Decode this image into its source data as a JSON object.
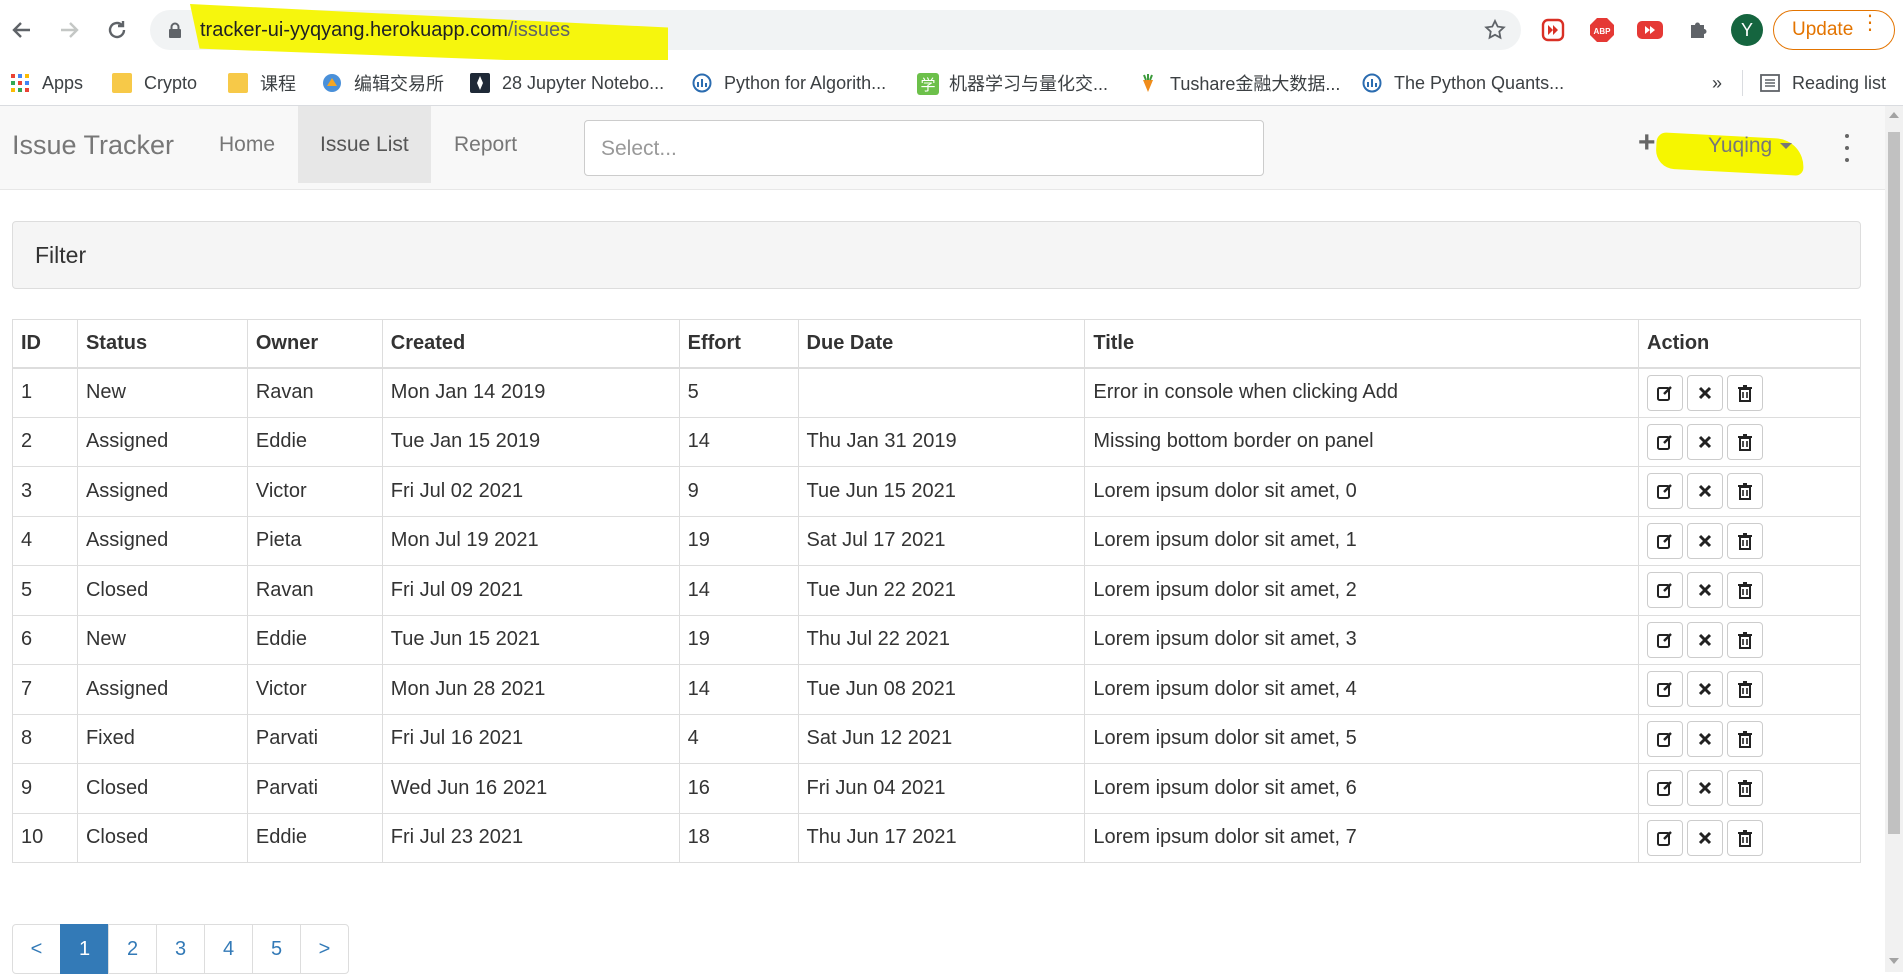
{
  "browser": {
    "url_host": "tracker-ui-yyqyang.herokuapp.com",
    "url_path": "/issues",
    "profile_initial": "Y",
    "update_label": "Update",
    "bookmarks": [
      {
        "label": "Apps",
        "icon": "apps-grid-icon"
      },
      {
        "label": "Crypto",
        "icon": "folder-icon"
      },
      {
        "label": "课程",
        "icon": "folder-icon"
      },
      {
        "label": "编辑交易所",
        "icon": "exchange-icon"
      },
      {
        "label": "28 Jupyter Notebo...",
        "icon": "jupyter-icon"
      },
      {
        "label": "Python for Algorith...",
        "icon": "site-icon"
      },
      {
        "label": "机器学习与量化交...",
        "icon": "xue-icon"
      },
      {
        "label": "Tushare金融大数据...",
        "icon": "carrot-icon"
      },
      {
        "label": "The Python Quants...",
        "icon": "site-icon"
      }
    ],
    "more_bookmarks": "»",
    "reading_list": "Reading list"
  },
  "navbar": {
    "brand": "Issue Tracker",
    "links": [
      "Home",
      "Issue List",
      "Report"
    ],
    "active_link": "Issue List",
    "select_placeholder": "Select...",
    "add_symbol": "+",
    "user": "Yuqing"
  },
  "filter": {
    "title": "Filter"
  },
  "table": {
    "headers": [
      "ID",
      "Status",
      "Owner",
      "Created",
      "Effort",
      "Due Date",
      "Title",
      "Action"
    ],
    "rows": [
      {
        "id": "1",
        "status": "New",
        "owner": "Ravan",
        "created": "Mon Jan 14 2019",
        "effort": "5",
        "due": "",
        "title": "Error in console when clicking Add"
      },
      {
        "id": "2",
        "status": "Assigned",
        "owner": "Eddie",
        "created": "Tue Jan 15 2019",
        "effort": "14",
        "due": "Thu Jan 31 2019",
        "title": "Missing bottom border on panel"
      },
      {
        "id": "3",
        "status": "Assigned",
        "owner": "Victor",
        "created": "Fri Jul 02 2021",
        "effort": "9",
        "due": "Tue Jun 15 2021",
        "title": "Lorem ipsum dolor sit amet, 0"
      },
      {
        "id": "4",
        "status": "Assigned",
        "owner": "Pieta",
        "created": "Mon Jul 19 2021",
        "effort": "19",
        "due": "Sat Jul 17 2021",
        "title": "Lorem ipsum dolor sit amet, 1"
      },
      {
        "id": "5",
        "status": "Closed",
        "owner": "Ravan",
        "created": "Fri Jul 09 2021",
        "effort": "14",
        "due": "Tue Jun 22 2021",
        "title": "Lorem ipsum dolor sit amet, 2"
      },
      {
        "id": "6",
        "status": "New",
        "owner": "Eddie",
        "created": "Tue Jun 15 2021",
        "effort": "19",
        "due": "Thu Jul 22 2021",
        "title": "Lorem ipsum dolor sit amet, 3"
      },
      {
        "id": "7",
        "status": "Assigned",
        "owner": "Victor",
        "created": "Mon Jun 28 2021",
        "effort": "14",
        "due": "Tue Jun 08 2021",
        "title": "Lorem ipsum dolor sit amet, 4"
      },
      {
        "id": "8",
        "status": "Fixed",
        "owner": "Parvati",
        "created": "Fri Jul 16 2021",
        "effort": "4",
        "due": "Sat Jun 12 2021",
        "title": "Lorem ipsum dolor sit amet, 5"
      },
      {
        "id": "9",
        "status": "Closed",
        "owner": "Parvati",
        "created": "Wed Jun 16 2021",
        "effort": "16",
        "due": "Fri Jun 04 2021",
        "title": "Lorem ipsum dolor sit amet, 6"
      },
      {
        "id": "10",
        "status": "Closed",
        "owner": "Eddie",
        "created": "Fri Jul 23 2021",
        "effort": "18",
        "due": "Thu Jun 17 2021",
        "title": "Lorem ipsum dolor sit amet, 7"
      }
    ],
    "action_icons": [
      "edit-icon",
      "close-icon",
      "trash-icon"
    ]
  },
  "pagination": {
    "prev": "<",
    "pages": [
      "1",
      "2",
      "3",
      "4",
      "5"
    ],
    "active_page": "1",
    "next": ">"
  },
  "colors": {
    "highlight": "#f6f600",
    "primary": "#337ab7",
    "update_orange": "#e37400",
    "profile_green": "#15653f"
  }
}
